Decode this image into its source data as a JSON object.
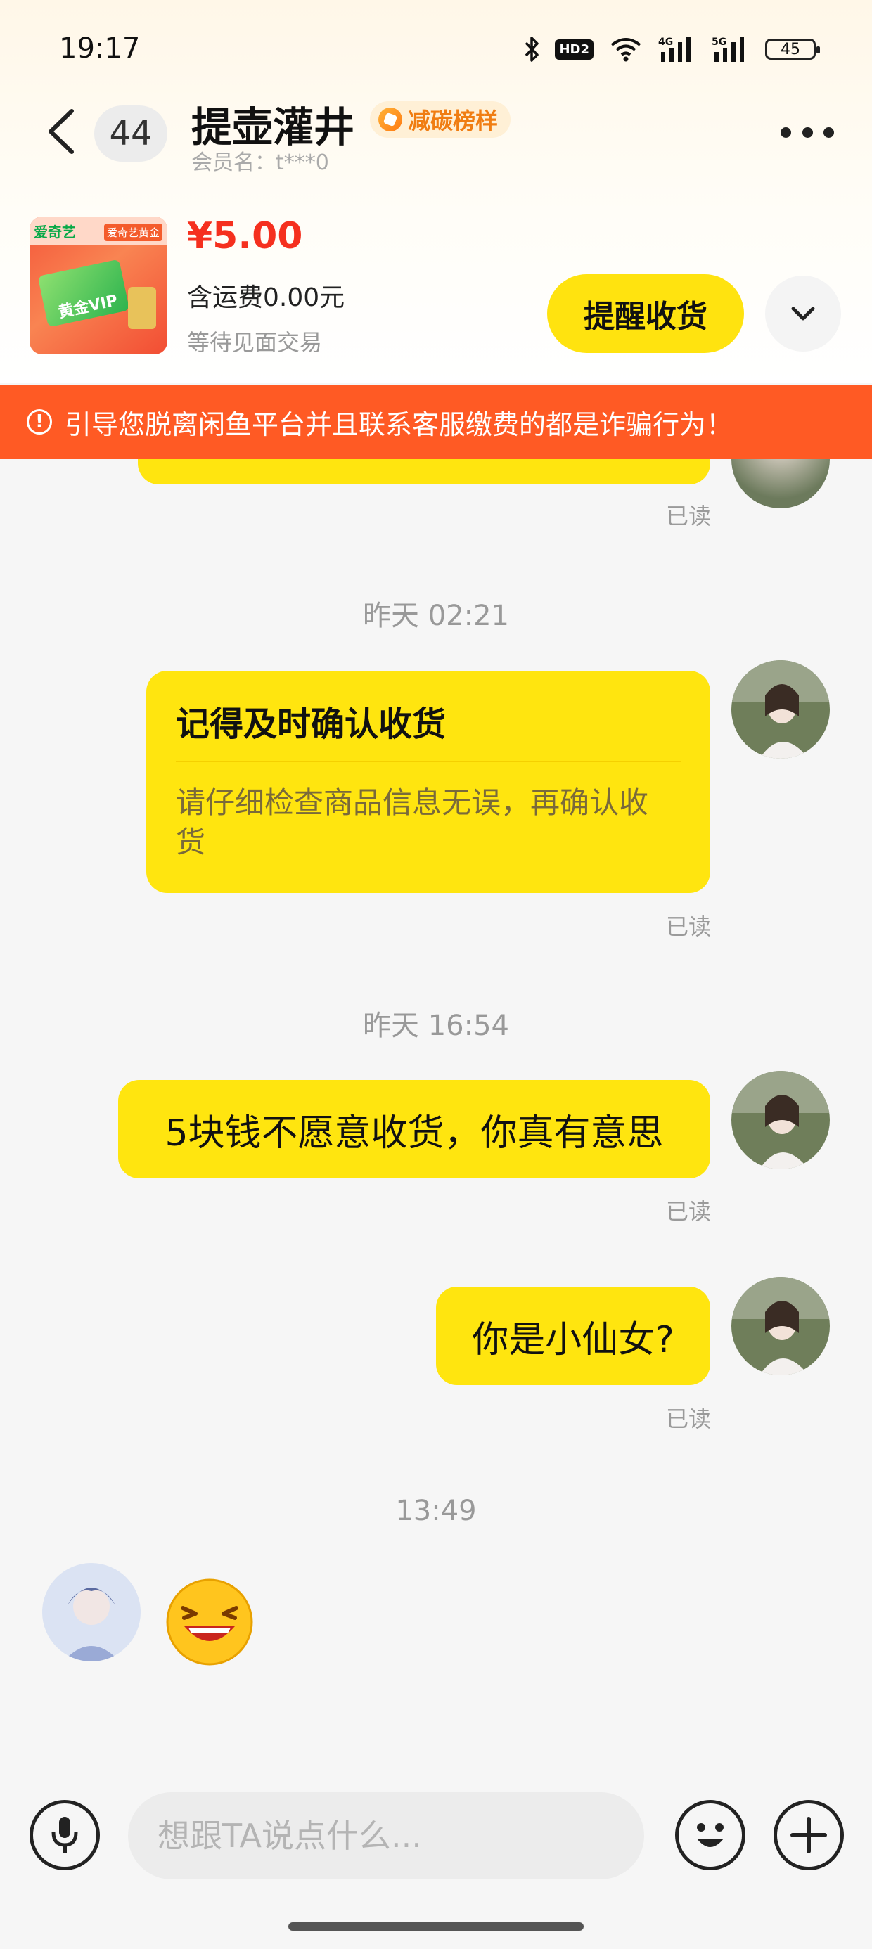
{
  "status_bar": {
    "time": "19:17",
    "battery": "45",
    "network_1": "4G",
    "network_2": "5G",
    "hd_badge": "HD2"
  },
  "header": {
    "unread_count": "44",
    "contact_name": "提壶灌井",
    "badge": "减碳榜样",
    "member_label": "会员名：t***0"
  },
  "product": {
    "image_text_1": "爱奇艺",
    "image_text_2": "爱奇艺黄金",
    "image_text_3": "黄金VIP",
    "price": "¥5.00",
    "shipping": "含运费0.00元",
    "status": "等待见面交易",
    "remind_button": "提醒收货"
  },
  "warning": {
    "text": "引导您脱离闲鱼平台并且联系客服缴费的都是诈骗行为！"
  },
  "messages": {
    "read_label": "已读",
    "ts1": "昨天 02:21",
    "card_title": "记得及时确认收货",
    "card_body": "请仔细检查商品信息无误，再确认收货",
    "ts2": "昨天 16:54",
    "msg1": "5块钱不愿意收货，你真有意思",
    "msg2": "你是小仙女?",
    "ts3": "13:49",
    "reply_emoji": "laughing-emoji"
  },
  "input": {
    "placeholder": "想跟TA说点什么..."
  },
  "colors": {
    "bubble": "#ffe50f",
    "warning": "#ff5a24",
    "price": "#f5301f",
    "badge_text": "#f07d12"
  }
}
